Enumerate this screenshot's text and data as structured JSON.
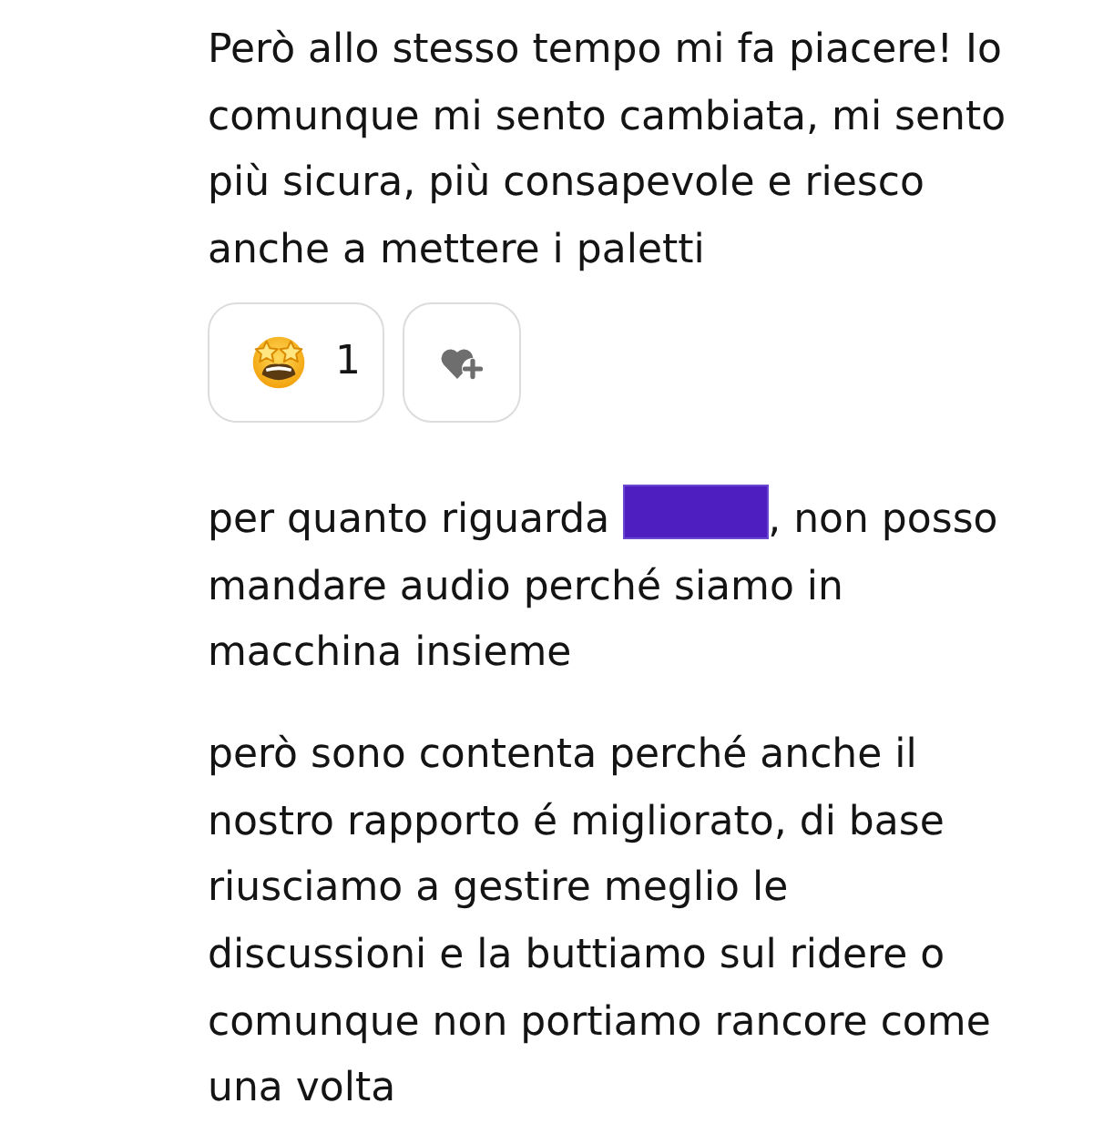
{
  "messages": [
    {
      "segments": [
        {
          "kind": "text",
          "text": "Però allo stesso tempo mi fa piacere! Io comunque mi sento cambiata, mi sento più sicura, più consapevole e riesco anche a mettere i paletti"
        }
      ],
      "reactions": [
        {
          "kind": "emoji",
          "count": "1"
        },
        {
          "kind": "add"
        }
      ]
    },
    {
      "segments": [
        {
          "kind": "text",
          "text": "per quanto riguarda "
        },
        {
          "kind": "redaction"
        },
        {
          "kind": "text",
          "text": ", non posso mandare audio perché siamo in macchina insieme"
        }
      ]
    },
    {
      "segments": [
        {
          "kind": "text",
          "text": "però sono contenta perché anche il nostro rapporto é migliorato, di base riusciamo a gestire meglio le discussioni e la buttiamo sul ridere o comunque non portiamo rancore come una volta"
        }
      ]
    }
  ]
}
